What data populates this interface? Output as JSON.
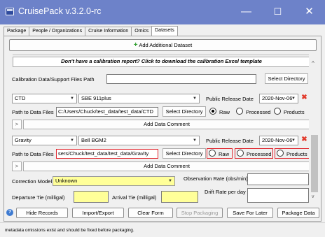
{
  "window": {
    "title": "CruisePack v.3.2.0-rc",
    "minimize": "—",
    "maximize": "☐",
    "close": "✕"
  },
  "tabs": [
    "Package",
    "People / Organizations",
    "Cruise Information",
    "Omics",
    "Datasets"
  ],
  "add_dataset_label": "Add Additional Dataset",
  "calibration_notice": "Don't have a calibration report? Click to download the calibration Excel template",
  "calibration": {
    "label": "Calibration Data/Support Files Path",
    "value": "",
    "button": "Select Directory"
  },
  "datasets": [
    {
      "type": "CTD",
      "instrument": "SBE 911plus",
      "release_label": "Public Release Date",
      "release_date": "2020-Nov-06",
      "path_label": "Path to Data Files",
      "path": "C:/Users/Chuck/test_data/test_data/CTD",
      "select_button": "Select Directory",
      "options": [
        "Raw",
        "Processed",
        "Products"
      ],
      "selected": "Raw",
      "add_comment": "Add Data Comment",
      "expander": ">"
    },
    {
      "type": "Gravity",
      "instrument": "Bell BGM2",
      "release_label": "Public Release Date",
      "release_date": "2020-Nov-06",
      "path_label": "Path to Data Files",
      "path": "sers/Chuck/test_data/test_data/Gravity",
      "select_button": "Select Directory",
      "options": [
        "Raw",
        "Processed",
        "Products"
      ],
      "selected": "",
      "add_comment": "Add Data Comment",
      "expander": ">"
    }
  ],
  "gravity_extra": {
    "correction_label": "Correction Model",
    "correction_value": "Unknown",
    "obs_rate_label": "Observation Rate (obs/min)",
    "departure_label": "Departure Tie (milligal)",
    "arrival_label": "Arrival Tie (milligal)",
    "drift_label": "Drift Rate per day"
  },
  "bottom_buttons": [
    "Hide Records",
    "Import/Export",
    "Clear Form",
    "Stop Packaging",
    "Save For Later",
    "Package Data"
  ],
  "status_message": "metadata omissions exist and should be fixed before packaging.",
  "colors": {
    "titlebar": "#6d82c9",
    "invalid": "#e0252d",
    "required": "#ffff99"
  }
}
